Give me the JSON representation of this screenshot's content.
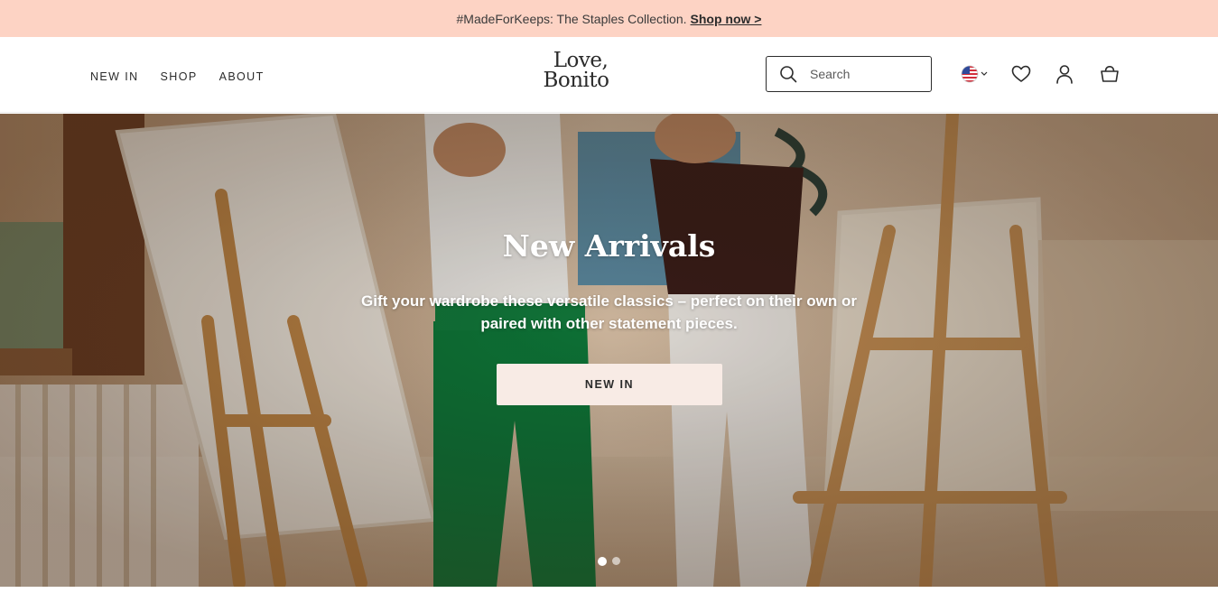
{
  "announcement": {
    "text": "#MadeForKeeps: The Staples Collection.",
    "link_label": "Shop now >"
  },
  "nav": {
    "items": [
      {
        "label": "NEW IN"
      },
      {
        "label": "SHOP"
      },
      {
        "label": "ABOUT"
      }
    ]
  },
  "logo": {
    "line1": "Love,",
    "line2": "Bonito"
  },
  "search": {
    "placeholder": "Search",
    "value": ""
  },
  "header_icons": [
    "us-flag-icon",
    "heart-icon",
    "user-icon",
    "shopping-bag-icon"
  ],
  "hero": {
    "title": "New Arrivals",
    "subtitle": "Gift your wardrobe these versatile classics – perfect on their own or paired with other statement pieces.",
    "cta_label": "NEW IN",
    "slides_total": 2,
    "active_slide": 1
  },
  "colors": {
    "announcement_bg": "#fdd3c4",
    "cta_bg": "#f8ebe5",
    "text_dark": "#2b2b2b"
  }
}
